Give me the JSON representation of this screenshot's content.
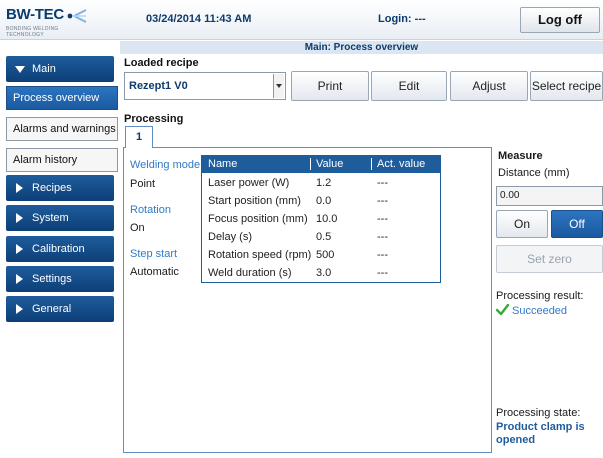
{
  "header": {
    "logo_text": "BW-TEC",
    "logo_tagline": "BONDING WELDING TECHNOLOGY",
    "datetime": "03/24/2014 11:43 AM",
    "login": "Login: ---",
    "logoff_label": "Log off"
  },
  "page_title": "Main: Process overview",
  "sidebar": {
    "main_label": "Main",
    "sub_items": [
      "Process overview",
      "Alarms and warnings",
      "Alarm history"
    ],
    "active_sub": "Process overview",
    "sections": [
      "Recipes",
      "System",
      "Calibration",
      "Settings",
      "General"
    ]
  },
  "recipe": {
    "section_label": "Loaded recipe",
    "selected": "Rezept1 V0",
    "buttons": [
      "Print",
      "Edit",
      "Adjust",
      "Select recipe"
    ]
  },
  "processing": {
    "section_label": "Processing",
    "tab": "1",
    "welding_mode_label": "Welding mode",
    "welding_mode_value": "Point",
    "rotation_label": "Rotation",
    "rotation_value": "On",
    "step_start_label": "Step start",
    "step_start_value": "Automatic",
    "columns": [
      "Name",
      "Value",
      "Act. value"
    ],
    "rows": [
      {
        "name": "Laser power (W)",
        "value": "1.2",
        "act": "---"
      },
      {
        "name": "Start position (mm)",
        "value": "0.0",
        "act": "---"
      },
      {
        "name": "Focus position (mm)",
        "value": "10.0",
        "act": "---"
      },
      {
        "name": "Delay (s)",
        "value": "0.5",
        "act": "---"
      },
      {
        "name": "Rotation speed (rpm)",
        "value": "500",
        "act": "---"
      },
      {
        "name": "Weld duration (s)",
        "value": "3.0",
        "act": "---"
      }
    ]
  },
  "measure": {
    "title": "Measure",
    "distance_label": "Distance (mm)",
    "distance_value": "0.00",
    "on_label": "On",
    "off_label": "Off",
    "set_zero_label": "Set zero",
    "result_label": "Processing result:",
    "result_value": "Succeeded",
    "state_label": "Processing state:",
    "state_value": "Product clamp is opened"
  },
  "colors": {
    "nav_blue": "#0c3f77",
    "active_blue": "#2e74c0",
    "accent_text": "#2f7bc8",
    "success_green": "#3aa83a"
  }
}
